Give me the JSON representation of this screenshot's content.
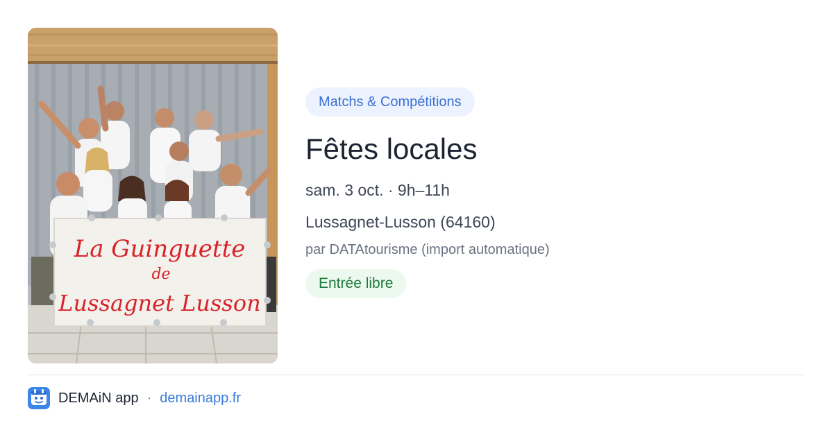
{
  "photo": {
    "sign_line1": "La Guinguette",
    "sign_line2": "de",
    "sign_line3": "Lussagnet Lusson"
  },
  "event": {
    "category": "Matchs & Compétitions",
    "title": "Fêtes locales",
    "datetime": "sam. 3 oct. · 9h–11h",
    "location": "Lussagnet-Lusson (64160)",
    "source": "par DATAtourisme (import automatique)",
    "price": "Entrée libre"
  },
  "footer": {
    "app_name": "DEMAiN app",
    "separator": "·",
    "domain": "demainapp.fr",
    "icon": "demain-app-icon"
  },
  "colors": {
    "chip_bg": "#edf3fe",
    "chip_text": "#3b6fd4",
    "price_bg": "#ecf9ef",
    "price_text": "#1f7a3a",
    "link": "#3b7bd9"
  }
}
